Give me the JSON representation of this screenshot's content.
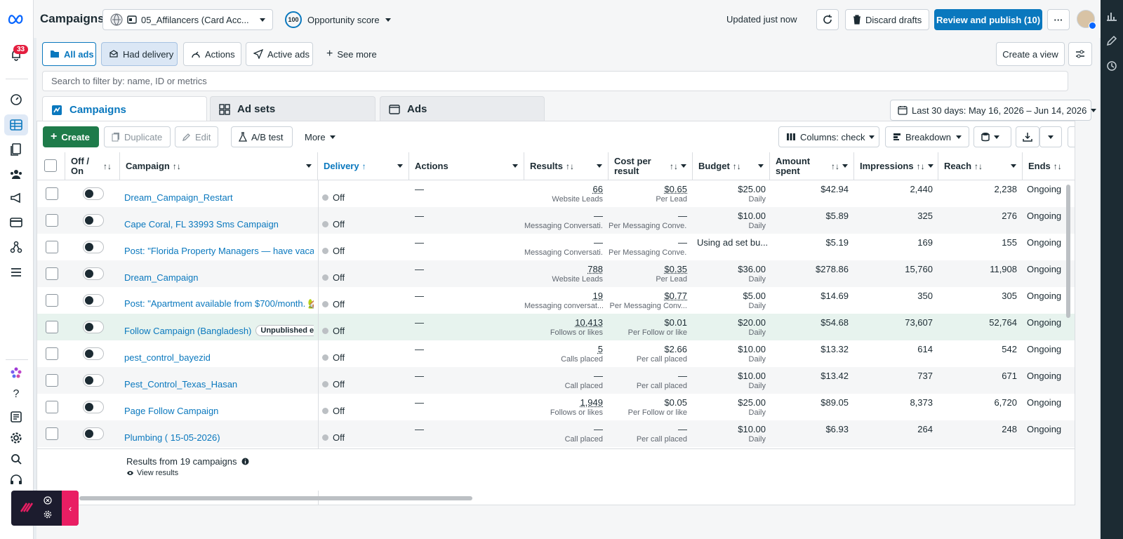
{
  "header": {
    "title": "Campaigns",
    "account_name": "05_Affilancers (Card Acc...",
    "opportunity_score": "100",
    "opportunity_label": "Opportunity score",
    "updated": "Updated just now",
    "discard": "Discard drafts",
    "publish": "Review and publish (10)",
    "more": "···"
  },
  "nav": {
    "notifications": "33"
  },
  "filters": {
    "all_ads": "All ads",
    "had_delivery": "Had delivery",
    "actions": "Actions",
    "active_ads": "Active ads",
    "see_more": "See more",
    "create_view": "Create a view"
  },
  "search": {
    "placeholder": "Search to filter by: name, ID or metrics"
  },
  "tabs": {
    "campaigns": "Campaigns",
    "adsets": "Ad sets",
    "ads": "Ads"
  },
  "date_range": "Last 30 days: May 16, 2026 – Jun 14, 2026",
  "toolbar": {
    "create": "Create",
    "duplicate": "Duplicate",
    "edit": "Edit",
    "ab_test": "A/B test",
    "more": "More",
    "columns": "Columns: check",
    "breakdown": "Breakdown"
  },
  "columns": {
    "offon": "Off / On",
    "campaign": "Campaign",
    "delivery": "Delivery",
    "actions": "Actions",
    "results": "Results",
    "cpr": "Cost per result",
    "budget": "Budget",
    "amount": "Amount spent",
    "impressions": "Impressions",
    "reach": "Reach",
    "ends": "Ends"
  },
  "rows": [
    {
      "name": "Dream_Campaign_Restart",
      "delivery": "Off",
      "actions": "—",
      "results": "66",
      "results_sub": "Website Leads",
      "cpr": "$0.65",
      "cpr_sub": "Per Lead",
      "budget": "$25.00",
      "budget_sub": "Daily",
      "amount": "$42.94",
      "impressions": "2,440",
      "reach": "2,238",
      "ends": "Ongoing"
    },
    {
      "name": "Cape Coral, FL 33993 Sms Campaign",
      "delivery": "Off",
      "actions": "—",
      "results": "—",
      "results_sub": "Messaging Conversati...",
      "cpr": "—",
      "cpr_sub": "Per Messaging Conve...",
      "budget": "$10.00",
      "budget_sub": "Daily",
      "amount": "$5.89",
      "impressions": "325",
      "reach": "276",
      "ends": "Ongoing"
    },
    {
      "name": "Post: \"Florida Property Managers — have vacant ...",
      "delivery": "Off",
      "actions": "—",
      "results": "—",
      "results_sub": "Messaging Conversati...",
      "cpr": "—",
      "cpr_sub": "Per Messaging Conve...",
      "budget": "Using ad set bu...",
      "budget_sub": "",
      "amount": "$5.19",
      "impressions": "169",
      "reach": "155",
      "ends": "Ongoing"
    },
    {
      "name": "Dream_Campaign",
      "delivery": "Off",
      "actions": "—",
      "results": "788",
      "results_sub": "Website Leads",
      "cpr": "$0.35",
      "cpr_sub": "Per Lead",
      "budget": "$36.00",
      "budget_sub": "Daily",
      "amount": "$278.86",
      "impressions": "15,760",
      "reach": "11,908",
      "ends": "Ongoing"
    },
    {
      "name": "Post: \"Apartment available from $700/month. 🏡\"",
      "delivery": "Off",
      "actions": "—",
      "results": "19",
      "results_sub": "Messaging conversat...",
      "cpr": "$0.77",
      "cpr_sub": "Per Messaging Conv...",
      "budget": "$5.00",
      "budget_sub": "Daily",
      "amount": "$14.69",
      "impressions": "350",
      "reach": "305",
      "ends": "Ongoing"
    },
    {
      "name": "Follow Campaign (Bangladesh)",
      "badge": "Unpublished edits",
      "delivery": "Off",
      "actions": "—",
      "results": "10,413",
      "results_sub": "Follows or likes",
      "cpr": "$0.01",
      "cpr_sub": "Per Follow or like",
      "budget": "$20.00",
      "budget_sub": "Daily",
      "amount": "$54.68",
      "impressions": "73,607",
      "reach": "52,764",
      "ends": "Ongoing"
    },
    {
      "name": "pest_control_bayezid",
      "delivery": "Off",
      "actions": "—",
      "results": "5",
      "results_sub": "Calls placed",
      "cpr": "$2.66",
      "cpr_sub": "Per call placed",
      "budget": "$10.00",
      "budget_sub": "Daily",
      "amount": "$13.32",
      "impressions": "614",
      "reach": "542",
      "ends": "Ongoing"
    },
    {
      "name": "Pest_Control_Texas_Hasan",
      "delivery": "Off",
      "actions": "—",
      "results": "—",
      "results_sub": "Call placed",
      "cpr": "—",
      "cpr_sub": "Per call placed",
      "budget": "$10.00",
      "budget_sub": "Daily",
      "amount": "$13.42",
      "impressions": "737",
      "reach": "671",
      "ends": "Ongoing"
    },
    {
      "name": "Page Follow Campaign",
      "delivery": "Off",
      "actions": "—",
      "results": "1,949",
      "results_sub": "Follows or likes",
      "cpr": "$0.05",
      "cpr_sub": "Per Follow or like",
      "budget": "$25.00",
      "budget_sub": "Daily",
      "amount": "$89.05",
      "impressions": "8,373",
      "reach": "6,720",
      "ends": "Ongoing"
    },
    {
      "name": "Plumbing ( 15-05-2026)",
      "delivery": "Off",
      "actions": "—",
      "results": "—",
      "results_sub": "Call placed",
      "cpr": "—",
      "cpr_sub": "Per call placed",
      "budget": "$10.00",
      "budget_sub": "Daily",
      "amount": "$6.93",
      "impressions": "264",
      "reach": "248",
      "ends": "Ongoing"
    }
  ],
  "footer": {
    "summary": "Results from 19 campaigns",
    "view_results": "View results"
  }
}
